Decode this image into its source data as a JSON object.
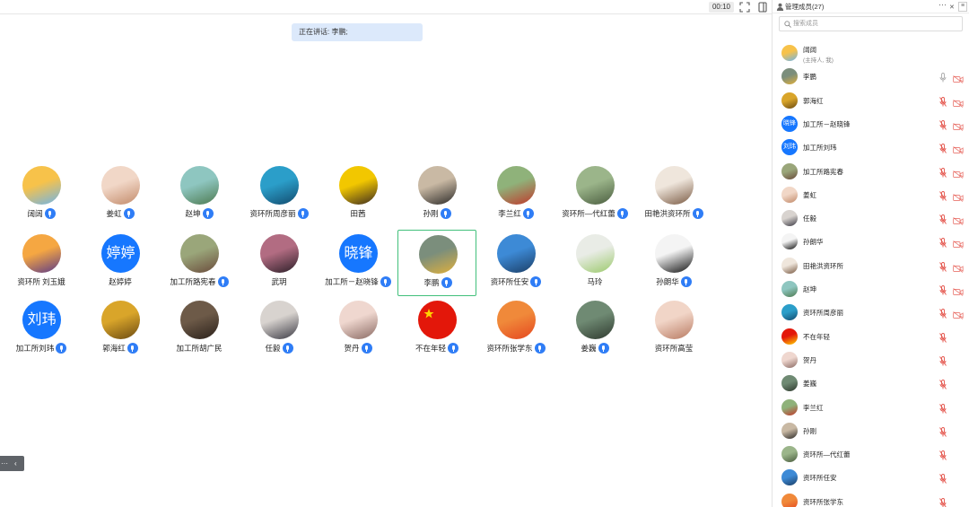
{
  "topbar": {
    "timer": "00:10"
  },
  "banner": {
    "speaking": "正在讲话: 李鹏;"
  },
  "tiles": [
    {
      "name": "阔阔",
      "mic": true,
      "avatar": "sunflower-photo",
      "colors": [
        "#f7c24a",
        "#6fb4e8"
      ]
    },
    {
      "name": "姜虹",
      "mic": true,
      "avatar": "child-photo",
      "colors": [
        "#f1d7c7",
        "#c28a6a"
      ]
    },
    {
      "name": "赵坤",
      "mic": true,
      "avatar": "waterfall-photo",
      "colors": [
        "#8ec6c0",
        "#4d7a50"
      ]
    },
    {
      "name": "资环所周彦丽",
      "mic": true,
      "avatar": "sea-photo",
      "colors": [
        "#2b9ec9",
        "#134b6e"
      ]
    },
    {
      "name": "田茜",
      "mic": false,
      "avatar": "portrait-photo",
      "colors": [
        "#f2c700",
        "#3b2a20"
      ]
    },
    {
      "name": "孙刚",
      "mic": true,
      "avatar": "portrait-photo",
      "colors": [
        "#c9b9a4",
        "#2c2a28"
      ]
    },
    {
      "name": "李兰红",
      "mic": true,
      "avatar": "flower-photo",
      "colors": [
        "#8fb27a",
        "#c0392b"
      ]
    },
    {
      "name": "资环所—代红蕾",
      "mic": true,
      "avatar": "people-photo",
      "colors": [
        "#9bb58a",
        "#4a5d3f"
      ]
    },
    {
      "name": "田艳洪资环所",
      "mic": true,
      "avatar": "portrait-photo",
      "colors": [
        "#efe6dc",
        "#7a5a43"
      ]
    },
    {
      "name": "资环所 刘玉娥",
      "mic": false,
      "avatar": "sunset-photo",
      "colors": [
        "#f5a742",
        "#5c3b88"
      ]
    },
    {
      "name": "赵婷婷",
      "mic": false,
      "avatar": "text",
      "text": "婷婷",
      "colors": [
        "#1677ff",
        "#1677ff"
      ]
    },
    {
      "name": "加工所路宪春",
      "mic": true,
      "avatar": "tree-photo",
      "colors": [
        "#9aa67a",
        "#6a4b3b"
      ]
    },
    {
      "name": "武玥",
      "mic": false,
      "avatar": "portrait-photo",
      "colors": [
        "#b26c82",
        "#2b1f28"
      ]
    },
    {
      "name": "加工所－赵晓锋",
      "mic": true,
      "avatar": "text",
      "text": "晓锋",
      "colors": [
        "#1677ff",
        "#1677ff"
      ]
    },
    {
      "name": "李鹏",
      "mic": true,
      "avatar": "rainbow-photo",
      "colors": [
        "#7b8e7c",
        "#e0b03c"
      ],
      "active": true
    },
    {
      "name": "资环所任安",
      "mic": true,
      "avatar": "palm-photo",
      "colors": [
        "#3d8ad6",
        "#1b3e66"
      ]
    },
    {
      "name": "马玲",
      "mic": false,
      "avatar": "sofa-photo",
      "colors": [
        "#e9ece6",
        "#9bc96b"
      ]
    },
    {
      "name": "孙朗华",
      "mic": true,
      "avatar": "portrait-photo",
      "colors": [
        "#f4f4f4",
        "#111111"
      ]
    },
    {
      "name": "加工所刘玮",
      "mic": true,
      "avatar": "text",
      "text": "刘玮",
      "colors": [
        "#1677ff",
        "#1677ff"
      ]
    },
    {
      "name": "郭海红",
      "mic": true,
      "avatar": "gold-photo",
      "colors": [
        "#d9a52a",
        "#6b4a12"
      ]
    },
    {
      "name": "加工所胡广民",
      "mic": false,
      "avatar": "portrait-photo",
      "colors": [
        "#6d5a48",
        "#2a201a"
      ]
    },
    {
      "name": "任毅",
      "mic": true,
      "avatar": "moon-photo",
      "colors": [
        "#d8d3cf",
        "#3b3a44"
      ]
    },
    {
      "name": "贺丹",
      "mic": true,
      "avatar": "portrait-photo",
      "colors": [
        "#efd7cf",
        "#8a6a63"
      ]
    },
    {
      "name": "不在年轻",
      "mic": true,
      "avatar": "flag-photo",
      "colors": [
        "#e3170a",
        "#ffd400"
      ]
    },
    {
      "name": "资环所张学东",
      "mic": true,
      "avatar": "sunset-photo",
      "colors": [
        "#f0893a",
        "#e5471f"
      ]
    },
    {
      "name": "姜巍",
      "mic": true,
      "avatar": "portrait-photo",
      "colors": [
        "#6f8a73",
        "#2f3a2f"
      ]
    },
    {
      "name": "资环所高莹",
      "mic": false,
      "avatar": "portrait-photo",
      "colors": [
        "#f1d5c7",
        "#b87a62"
      ]
    }
  ],
  "panel": {
    "title": "管理成员(27)",
    "more": "···",
    "close": "✕",
    "menu": "≡",
    "search_placeholder": "搜索成员",
    "members": [
      {
        "name": "阔阔",
        "sub": "(主持人, 我)",
        "host": true,
        "avatar": "photo",
        "colors": [
          "#f7c24a",
          "#6fb4e8"
        ],
        "mic": "none",
        "cam": "none"
      },
      {
        "name": "李鹏",
        "avatar": "photo",
        "colors": [
          "#7b8e7c",
          "#e0b03c"
        ],
        "mic": "on",
        "cam": "off"
      },
      {
        "name": "郭海红",
        "avatar": "photo",
        "colors": [
          "#d9a52a",
          "#6b4a12"
        ],
        "mic": "muted",
        "cam": "off"
      },
      {
        "name": "加工所－赵晓锋",
        "avatar": "text",
        "text": "晓锋",
        "colors": [
          "#1677ff"
        ],
        "mic": "muted",
        "cam": "off"
      },
      {
        "name": "加工所刘玮",
        "avatar": "text",
        "text": "刘玮",
        "colors": [
          "#1677ff"
        ],
        "mic": "muted",
        "cam": "off"
      },
      {
        "name": "加工所路宪春",
        "avatar": "photo",
        "colors": [
          "#9aa67a",
          "#6a4b3b"
        ],
        "mic": "muted",
        "cam": "off"
      },
      {
        "name": "姜虹",
        "avatar": "photo",
        "colors": [
          "#f1d7c7",
          "#c28a6a"
        ],
        "mic": "muted",
        "cam": "off"
      },
      {
        "name": "任毅",
        "avatar": "photo",
        "colors": [
          "#d8d3cf",
          "#3b3a44"
        ],
        "mic": "muted",
        "cam": "off"
      },
      {
        "name": "孙朗华",
        "avatar": "photo",
        "colors": [
          "#f4f4f4",
          "#111111"
        ],
        "mic": "muted",
        "cam": "off"
      },
      {
        "name": "田艳洪资环所",
        "avatar": "photo",
        "colors": [
          "#efe6dc",
          "#7a5a43"
        ],
        "mic": "muted",
        "cam": "off"
      },
      {
        "name": "赵坤",
        "avatar": "photo",
        "colors": [
          "#8ec6c0",
          "#4d7a50"
        ],
        "mic": "muted",
        "cam": "off"
      },
      {
        "name": "资环所周彦丽",
        "avatar": "photo",
        "colors": [
          "#2b9ec9",
          "#134b6e"
        ],
        "mic": "muted",
        "cam": "off"
      },
      {
        "name": "不在年轻",
        "avatar": "photo",
        "colors": [
          "#e3170a",
          "#ffd400"
        ],
        "mic": "muted",
        "cam": "none"
      },
      {
        "name": "贺丹",
        "avatar": "photo",
        "colors": [
          "#efd7cf",
          "#8a6a63"
        ],
        "mic": "muted",
        "cam": "none"
      },
      {
        "name": "姜巍",
        "avatar": "photo",
        "colors": [
          "#6f8a73",
          "#2f3a2f"
        ],
        "mic": "muted",
        "cam": "none"
      },
      {
        "name": "李兰红",
        "avatar": "photo",
        "colors": [
          "#8fb27a",
          "#c0392b"
        ],
        "mic": "muted",
        "cam": "none"
      },
      {
        "name": "孙刚",
        "avatar": "photo",
        "colors": [
          "#c9b9a4",
          "#2c2a28"
        ],
        "mic": "muted",
        "cam": "none"
      },
      {
        "name": "资环所—代红蕾",
        "avatar": "photo",
        "colors": [
          "#9bb58a",
          "#4a5d3f"
        ],
        "mic": "muted",
        "cam": "none"
      },
      {
        "name": "资环所任安",
        "avatar": "photo",
        "colors": [
          "#3d8ad6",
          "#1b3e66"
        ],
        "mic": "muted",
        "cam": "none"
      },
      {
        "name": "资环所张学东",
        "avatar": "photo",
        "colors": [
          "#f0893a",
          "#e5471f"
        ],
        "mic": "muted",
        "cam": "none"
      }
    ]
  },
  "left_tab": {
    "dots": "···",
    "arrow": "‹"
  },
  "colors": {
    "accent": "#1677ff",
    "active_border": "#42c07b",
    "banner_bg": "#dce9fb",
    "muted_red": "#e4534a"
  }
}
